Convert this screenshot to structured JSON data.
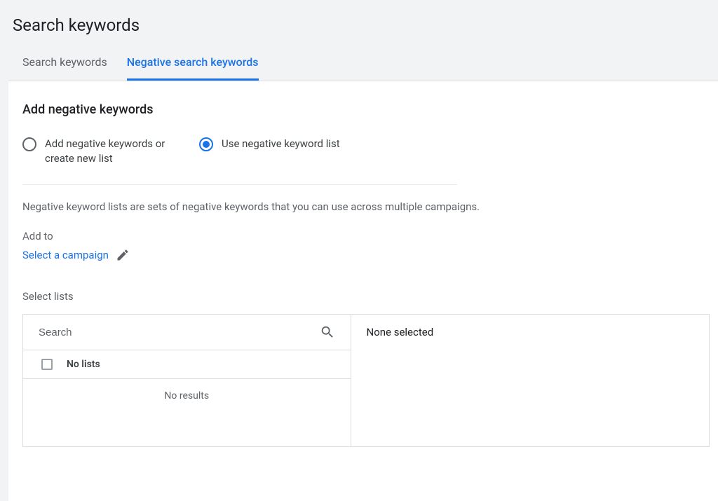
{
  "header": {
    "title": "Search keywords"
  },
  "tabs": {
    "search_keywords": "Search keywords",
    "negative_search_keywords": "Negative search keywords",
    "active": "negative_search_keywords"
  },
  "panel": {
    "heading": "Add negative keywords",
    "radio_create": "Add negative keywords or create new list",
    "radio_use_list": "Use negative keyword list",
    "selected_radio": "use_list",
    "help_text": "Negative keyword lists are sets of negative keywords that you can use across multiple campaigns.",
    "add_to_label": "Add to",
    "select_campaign_label": "Select a campaign",
    "select_lists_label": "Select lists"
  },
  "lists": {
    "search_placeholder": "Search",
    "column_label": "No lists",
    "empty_message": "No results",
    "selection_status": "None selected"
  },
  "colors": {
    "accent": "#1a73e8",
    "text_primary": "#202124",
    "text_secondary": "#5f6368",
    "border": "#dadce0",
    "page_bg": "#f1f3f4"
  }
}
